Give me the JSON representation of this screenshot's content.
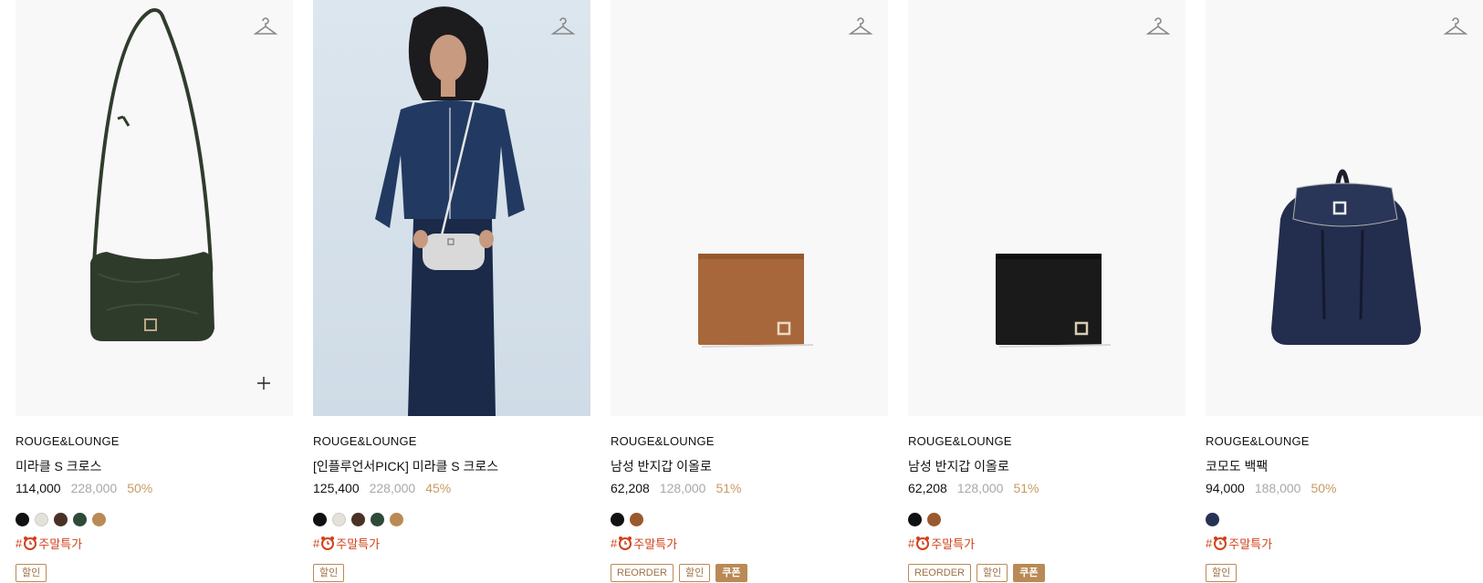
{
  "colors": {
    "discount": "#c79a62",
    "tag_red": "#d0421b",
    "badge_border": "#b98a55"
  },
  "products": [
    {
      "brand": "ROUGE&LOUNGE",
      "name": "미라클 S 크로스",
      "price": "114,000",
      "original_price": "228,000",
      "discount": "50%",
      "swatches": [
        "#111111",
        "#e4e1da",
        "#4a3126",
        "#2f4a38",
        "#b98a55"
      ],
      "tag": {
        "prefix": "#",
        "icon": "alarm-clock-icon",
        "text": "주말특가"
      },
      "badges": [
        {
          "label": "할인",
          "filled": false
        }
      ],
      "image": "green crossbody bag"
    },
    {
      "brand": "ROUGE&LOUNGE",
      "name": "[인플루언서PICK] 미라클 S 크로스",
      "price": "125,400",
      "original_price": "228,000",
      "discount": "45%",
      "swatches": [
        "#111111",
        "#e4e1da",
        "#4a3126",
        "#2f4a38",
        "#b98a55"
      ],
      "tag": {
        "prefix": "#",
        "icon": "alarm-clock-icon",
        "text": "주말특가"
      },
      "badges": [
        {
          "label": "할인",
          "filled": false
        }
      ],
      "image": "model wearing crossbody"
    },
    {
      "brand": "ROUGE&LOUNGE",
      "name": "남성 반지갑 이올로",
      "price": "62,208",
      "original_price": "128,000",
      "discount": "51%",
      "swatches": [
        "#111111",
        "#9a5a2e"
      ],
      "tag": {
        "prefix": "#",
        "icon": "alarm-clock-icon",
        "text": "주말특가"
      },
      "badges": [
        {
          "label": "REORDER",
          "filled": false
        },
        {
          "label": "할인",
          "filled": false
        },
        {
          "label": "쿠폰",
          "filled": true
        }
      ],
      "image": "tan bifold wallet"
    },
    {
      "brand": "ROUGE&LOUNGE",
      "name": "남성 반지갑 이올로",
      "price": "62,208",
      "original_price": "128,000",
      "discount": "51%",
      "swatches": [
        "#111111",
        "#9a5a2e"
      ],
      "tag": {
        "prefix": "#",
        "icon": "alarm-clock-icon",
        "text": "주말특가"
      },
      "badges": [
        {
          "label": "REORDER",
          "filled": false
        },
        {
          "label": "할인",
          "filled": false
        },
        {
          "label": "쿠폰",
          "filled": true
        }
      ],
      "image": "black bifold wallet"
    },
    {
      "brand": "ROUGE&LOUNGE",
      "name": "코모도 백팩",
      "price": "94,000",
      "original_price": "188,000",
      "discount": "50%",
      "swatches": [
        "#263355"
      ],
      "tag": {
        "prefix": "#",
        "icon": "alarm-clock-icon",
        "text": "주말특가"
      },
      "badges": [
        {
          "label": "할인",
          "filled": false
        }
      ],
      "image": "navy backpack"
    }
  ]
}
